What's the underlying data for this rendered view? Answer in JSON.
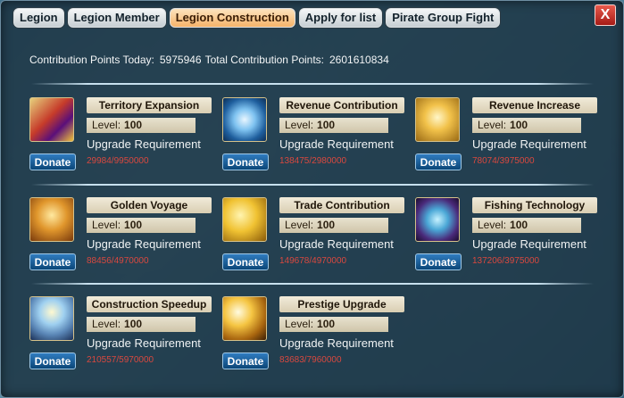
{
  "tabs": [
    {
      "label": "Legion",
      "active": false
    },
    {
      "label": "Legion Member",
      "active": false
    },
    {
      "label": "Legion Construction",
      "active": true
    },
    {
      "label": "Apply for list",
      "active": false
    },
    {
      "label": "Pirate Group Fight",
      "active": false
    }
  ],
  "close_label": "X",
  "points": {
    "today_label": "Contribution Points Today:",
    "today_value": "5975946",
    "total_label": "Total Contribution Points:",
    "total_value": "2601610834"
  },
  "item_labels": {
    "level": "Level:",
    "upgrade": "Upgrade Requirement",
    "donate": "Donate"
  },
  "items": [
    {
      "name": "Territory Expansion",
      "level": "100",
      "requirement": "29984/9950000",
      "icon": "territory-map-icon"
    },
    {
      "name": "Revenue Contribution",
      "level": "100",
      "requirement": "138475/2980000",
      "icon": "diamond-icon"
    },
    {
      "name": "Revenue Increase",
      "level": "100",
      "requirement": "78074/3975000",
      "icon": "gold-triangle-icon"
    },
    {
      "name": "Golden Voyage",
      "level": "100",
      "requirement": "88456/4970000",
      "icon": "gold-treasure-icon"
    },
    {
      "name": "Trade Contribution",
      "level": "100",
      "requirement": "149678/4970000",
      "icon": "gold-coins-icon"
    },
    {
      "name": "Fishing Technology",
      "level": "100",
      "requirement": "137206/3975000",
      "icon": "fishing-orb-icon"
    },
    {
      "name": "Construction Speedup",
      "level": "100",
      "requirement": "210557/5970000",
      "icon": "silver-pile-icon"
    },
    {
      "name": "Prestige Upgrade",
      "level": "100",
      "requirement": "83683/7960000",
      "icon": "golden-light-icon"
    }
  ]
}
